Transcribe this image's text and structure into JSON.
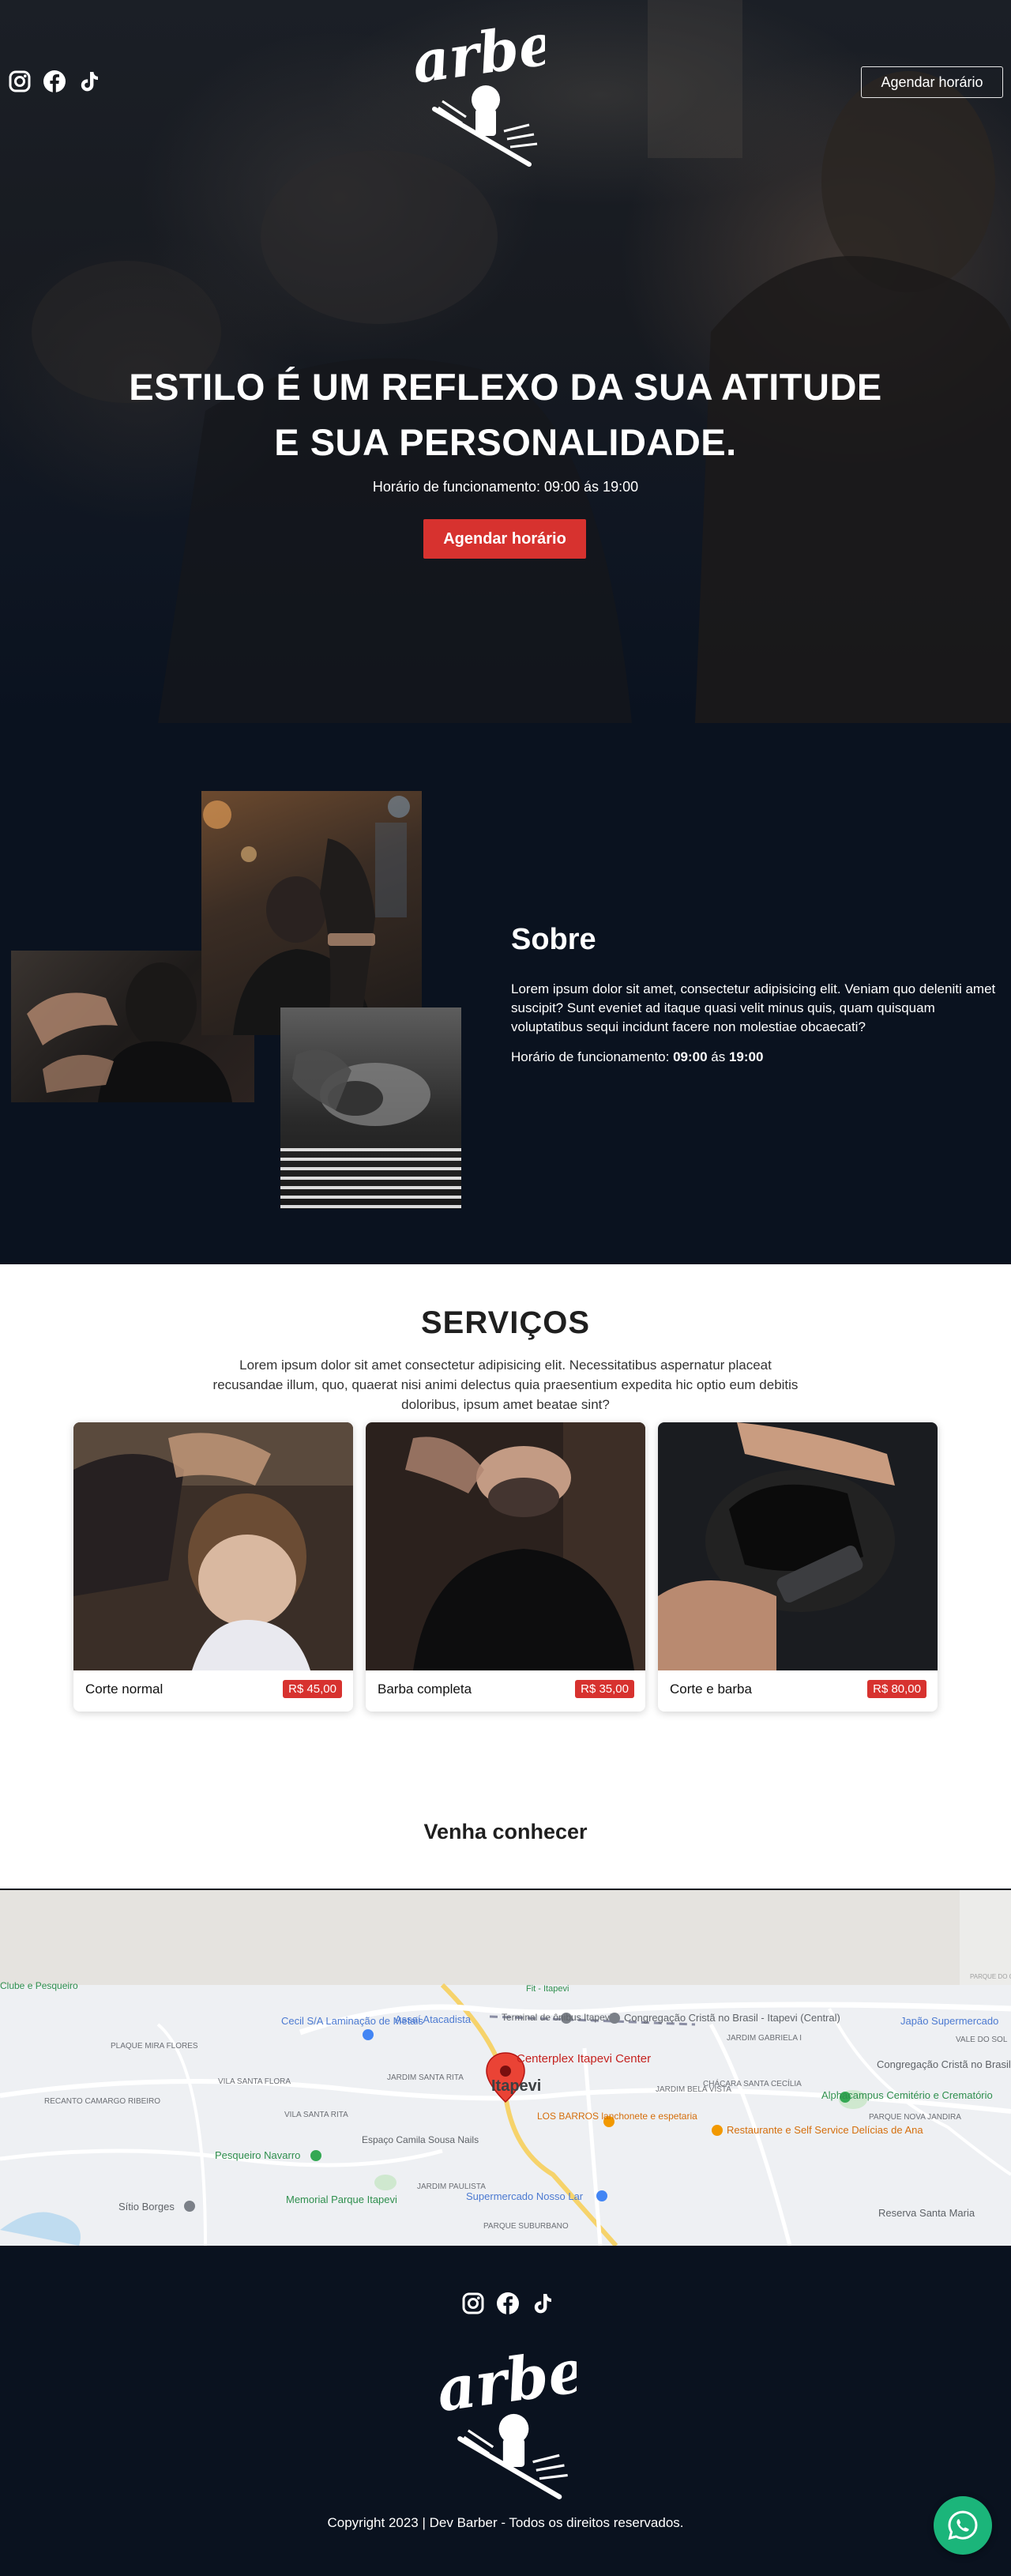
{
  "header": {
    "social_icons": [
      "instagram-icon",
      "facebook-icon",
      "tiktok-icon"
    ],
    "logo_text": "Barber",
    "cta_label": "Agendar horário"
  },
  "hero": {
    "title_line1": "ESTILO É UM REFLEXO DA SUA ATITUDE",
    "title_line2": "E SUA PERSONALIDADE.",
    "hours": "Horário de funcionamento: 09:00 ás 19:00",
    "cta_label": "Agendar horário"
  },
  "sobre": {
    "title": "Sobre",
    "text": "Lorem ipsum dolor sit amet, consectetur adipisicing elit. Veniam quo deleniti amet suscipit? Sunt eveniet ad itaque quasi velit minus quis, quam quisquam voluptatibus sequi incidunt facere non molestiae obcaecati?",
    "hours_prefix": "Horário de funcionamento: ",
    "hours_open": "09:00",
    "hours_mid": " ás ",
    "hours_close": "19:00"
  },
  "servicos": {
    "title": "SERVIÇOS",
    "text": "Lorem ipsum dolor sit amet consectetur adipisicing elit. Necessitatibus aspernatur placeat recusandae illum, quo, quaerat nisi animi delectus quia praesentium expedita hic optio eum debitis doloribus, ipsum amet beatae sint?",
    "cards": [
      {
        "name": "Corte normal",
        "price": "R$ 45,00"
      },
      {
        "name": "Barba completa",
        "price": "R$ 35,00"
      },
      {
        "name": "Corte e barba",
        "price": "R$ 80,00"
      }
    ]
  },
  "location": {
    "title": "Venha conhecer"
  },
  "map": {
    "labels": {
      "pin": "Centerplex Itapevi Center",
      "city": "Itapevi",
      "cecil": "Cecil S/A Laminação de Metais",
      "assai": "Assaí Atacadista",
      "terminal": "Terminal de ônibus Itapevi",
      "congregacao1": "Congregação Cristã no Brasil - Itapevi (Central)",
      "japao": "Japão Supermercado",
      "congregacao2": "Congregação Cristã no Brasil - Granja Alvorada",
      "alphacampus": "Alphacampus Cemitério e Crematório",
      "restaurante": "Restaurante e Self Service Delícias de Ana",
      "barros": "LOS BARROS lanchonete e espetaria",
      "espaco": "Espaço Camila Sousa Nails",
      "pesqueiro": "Pesqueiro Navarro",
      "memorial": "Memorial Parque Itapevi",
      "sitio": "Sítio Borges",
      "nossolar": "Supermercado Nosso Lar",
      "reserva": "Reserva Santa Maria",
      "plaque": "PLAQUE MIRA FLORES",
      "recanto": "RECANTO CAMARGO RIBEIRO",
      "vilasanta": "VILA SANTA FLORA",
      "jardimsanta": "JARDIM SANTA RITA",
      "jardimgabriela": "JARDIM GABRIELA I",
      "chacara": "CHÁCARA SANTA CECÍLIA",
      "belavista": "JARDIM BELA VISTA",
      "parquenova": "PARQUE NOVA JANDIRA",
      "valedosol": "VALE DO SOL",
      "paulista": "JARDIM PAULISTA",
      "suburbano": "PARQUE SUBURBANO",
      "vilasantarita": "VILA SANTA RITA",
      "fitpevi": "Fit - Itapevi",
      "clube": "Clube e Pesqueiro",
      "camargo": "PARQUE DO CAMARGO"
    }
  },
  "footer": {
    "social_icons": [
      "instagram-icon",
      "facebook-icon",
      "tiktok-icon"
    ],
    "logo_text": "Barber",
    "copyright": "Copyright 2023 | Dev Barber - Todos os direitos reservados."
  },
  "colors": {
    "accent_red": "#d7322f",
    "navy": "#0a121f",
    "whatsapp": "#1bb57a"
  }
}
